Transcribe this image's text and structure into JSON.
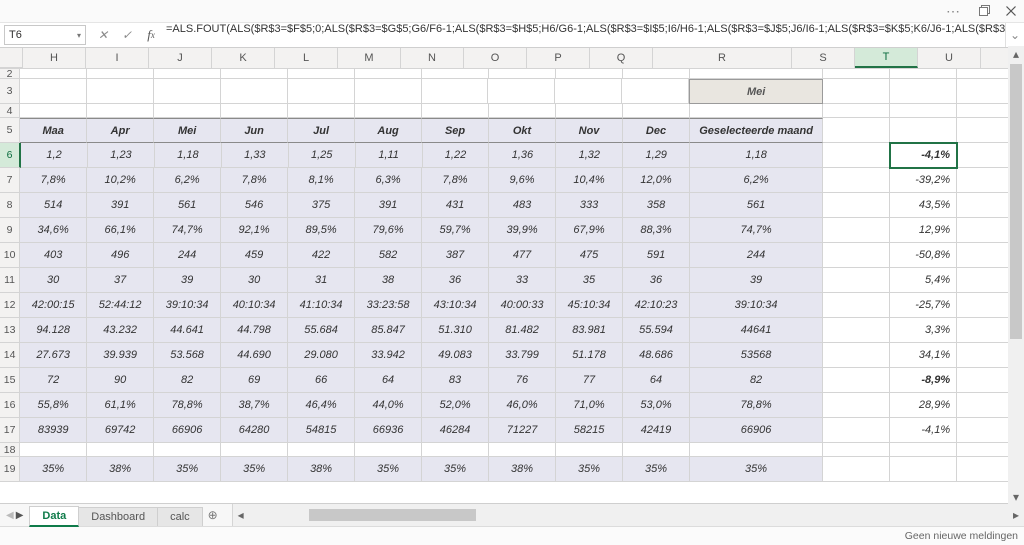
{
  "window": {
    "namebox": "T6",
    "formula": "=ALS.FOUT(ALS($R$3=$F$5;0;ALS($R$3=$G$5;G6/F6-1;ALS($R$3=$H$5;H6/G6-1;ALS($R$3=$I$5;I6/H6-1;ALS($R$3=$J$5;J6/I6-1;ALS($R$3=$K$5;K6/J6-1;ALS($R$3",
    "status": "Geen nieuwe meldingen"
  },
  "tabs": [
    "Data",
    "Dashboard",
    "calc"
  ],
  "active_tab": 0,
  "columns": [
    "H",
    "I",
    "J",
    "K",
    "L",
    "M",
    "N",
    "O",
    "P",
    "Q",
    "R",
    "S",
    "T",
    "U"
  ],
  "active_col": "T",
  "active_row": 6,
  "dropdown_value": "Mei",
  "headers": {
    "H": "Maa",
    "I": "Apr",
    "J": "Mei",
    "K": "Jun",
    "L": "Jul",
    "M": "Aug",
    "N": "Sep",
    "O": "Okt",
    "P": "Nov",
    "Q": "Dec",
    "R": "Geselecteerde maand"
  },
  "rows_visible": [
    2,
    3,
    4,
    5,
    6,
    7,
    8,
    9,
    10,
    11,
    12,
    13,
    14,
    15,
    16,
    17,
    18,
    19
  ],
  "data": {
    "6": {
      "H": "1,2",
      "I": "1,23",
      "J": "1,18",
      "K": "1,33",
      "L": "1,25",
      "M": "1,11",
      "N": "1,22",
      "O": "1,36",
      "P": "1,32",
      "Q": "1,29",
      "R": "1,18",
      "T": "-4,1%",
      "T_bold": true
    },
    "7": {
      "H": "7,8%",
      "I": "10,2%",
      "J": "6,2%",
      "K": "7,8%",
      "L": "8,1%",
      "M": "6,3%",
      "N": "7,8%",
      "O": "9,6%",
      "P": "10,4%",
      "Q": "12,0%",
      "R": "6,2%",
      "T": "-39,2%"
    },
    "8": {
      "H": "514",
      "I": "391",
      "J": "561",
      "K": "546",
      "L": "375",
      "M": "391",
      "N": "431",
      "O": "483",
      "P": "333",
      "Q": "358",
      "R": "561",
      "T": "43,5%"
    },
    "9": {
      "H": "34,6%",
      "I": "66,1%",
      "J": "74,7%",
      "K": "92,1%",
      "L": "89,5%",
      "M": "79,6%",
      "N": "59,7%",
      "O": "39,9%",
      "P": "67,9%",
      "Q": "88,3%",
      "R": "74,7%",
      "T": "12,9%"
    },
    "10": {
      "H": "403",
      "I": "496",
      "J": "244",
      "K": "459",
      "L": "422",
      "M": "582",
      "N": "387",
      "O": "477",
      "P": "475",
      "Q": "591",
      "R": "244",
      "T": "-50,8%"
    },
    "11": {
      "H": "30",
      "I": "37",
      "J": "39",
      "K": "30",
      "L": "31",
      "M": "38",
      "N": "36",
      "O": "33",
      "P": "35",
      "Q": "36",
      "R": "39",
      "T": "5,4%"
    },
    "12": {
      "H": "42:00:15",
      "I": "52:44:12",
      "J": "39:10:34",
      "K": "40:10:34",
      "L": "41:10:34",
      "M": "33:23:58",
      "N": "43:10:34",
      "O": "40:00:33",
      "P": "45:10:34",
      "Q": "42:10:23",
      "R": "39:10:34",
      "T": "-25,7%"
    },
    "13": {
      "H": "94.128",
      "I": "43.232",
      "J": "44.641",
      "K": "44.798",
      "L": "55.684",
      "M": "85.847",
      "N": "51.310",
      "O": "81.482",
      "P": "83.981",
      "Q": "55.594",
      "R": "44641",
      "T": "3,3%"
    },
    "14": {
      "H": "27.673",
      "I": "39.939",
      "J": "53.568",
      "K": "44.690",
      "L": "29.080",
      "M": "33.942",
      "N": "49.083",
      "O": "33.799",
      "P": "51.178",
      "Q": "48.686",
      "R": "53568",
      "T": "34,1%"
    },
    "15": {
      "H": "72",
      "I": "90",
      "J": "82",
      "K": "69",
      "L": "66",
      "M": "64",
      "N": "83",
      "O": "76",
      "P": "77",
      "Q": "64",
      "R": "82",
      "T": "-8,9%",
      "T_bold": true
    },
    "16": {
      "H": "55,8%",
      "I": "61,1%",
      "J": "78,8%",
      "K": "38,7%",
      "L": "46,4%",
      "M": "44,0%",
      "N": "52,0%",
      "O": "46,0%",
      "P": "71,0%",
      "Q": "53,0%",
      "R": "78,8%",
      "T": "28,9%"
    },
    "17": {
      "H": "83939",
      "I": "69742",
      "J": "66906",
      "K": "64280",
      "L": "54815",
      "M": "66936",
      "N": "46284",
      "O": "71227",
      "P": "58215",
      "Q": "42419",
      "R": "66906",
      "T": "-4,1%"
    },
    "18": {},
    "19": {
      "H": "35%",
      "I": "38%",
      "J": "35%",
      "K": "35%",
      "L": "38%",
      "M": "35%",
      "N": "35%",
      "O": "38%",
      "P": "35%",
      "Q": "35%",
      "R": "35%"
    }
  }
}
